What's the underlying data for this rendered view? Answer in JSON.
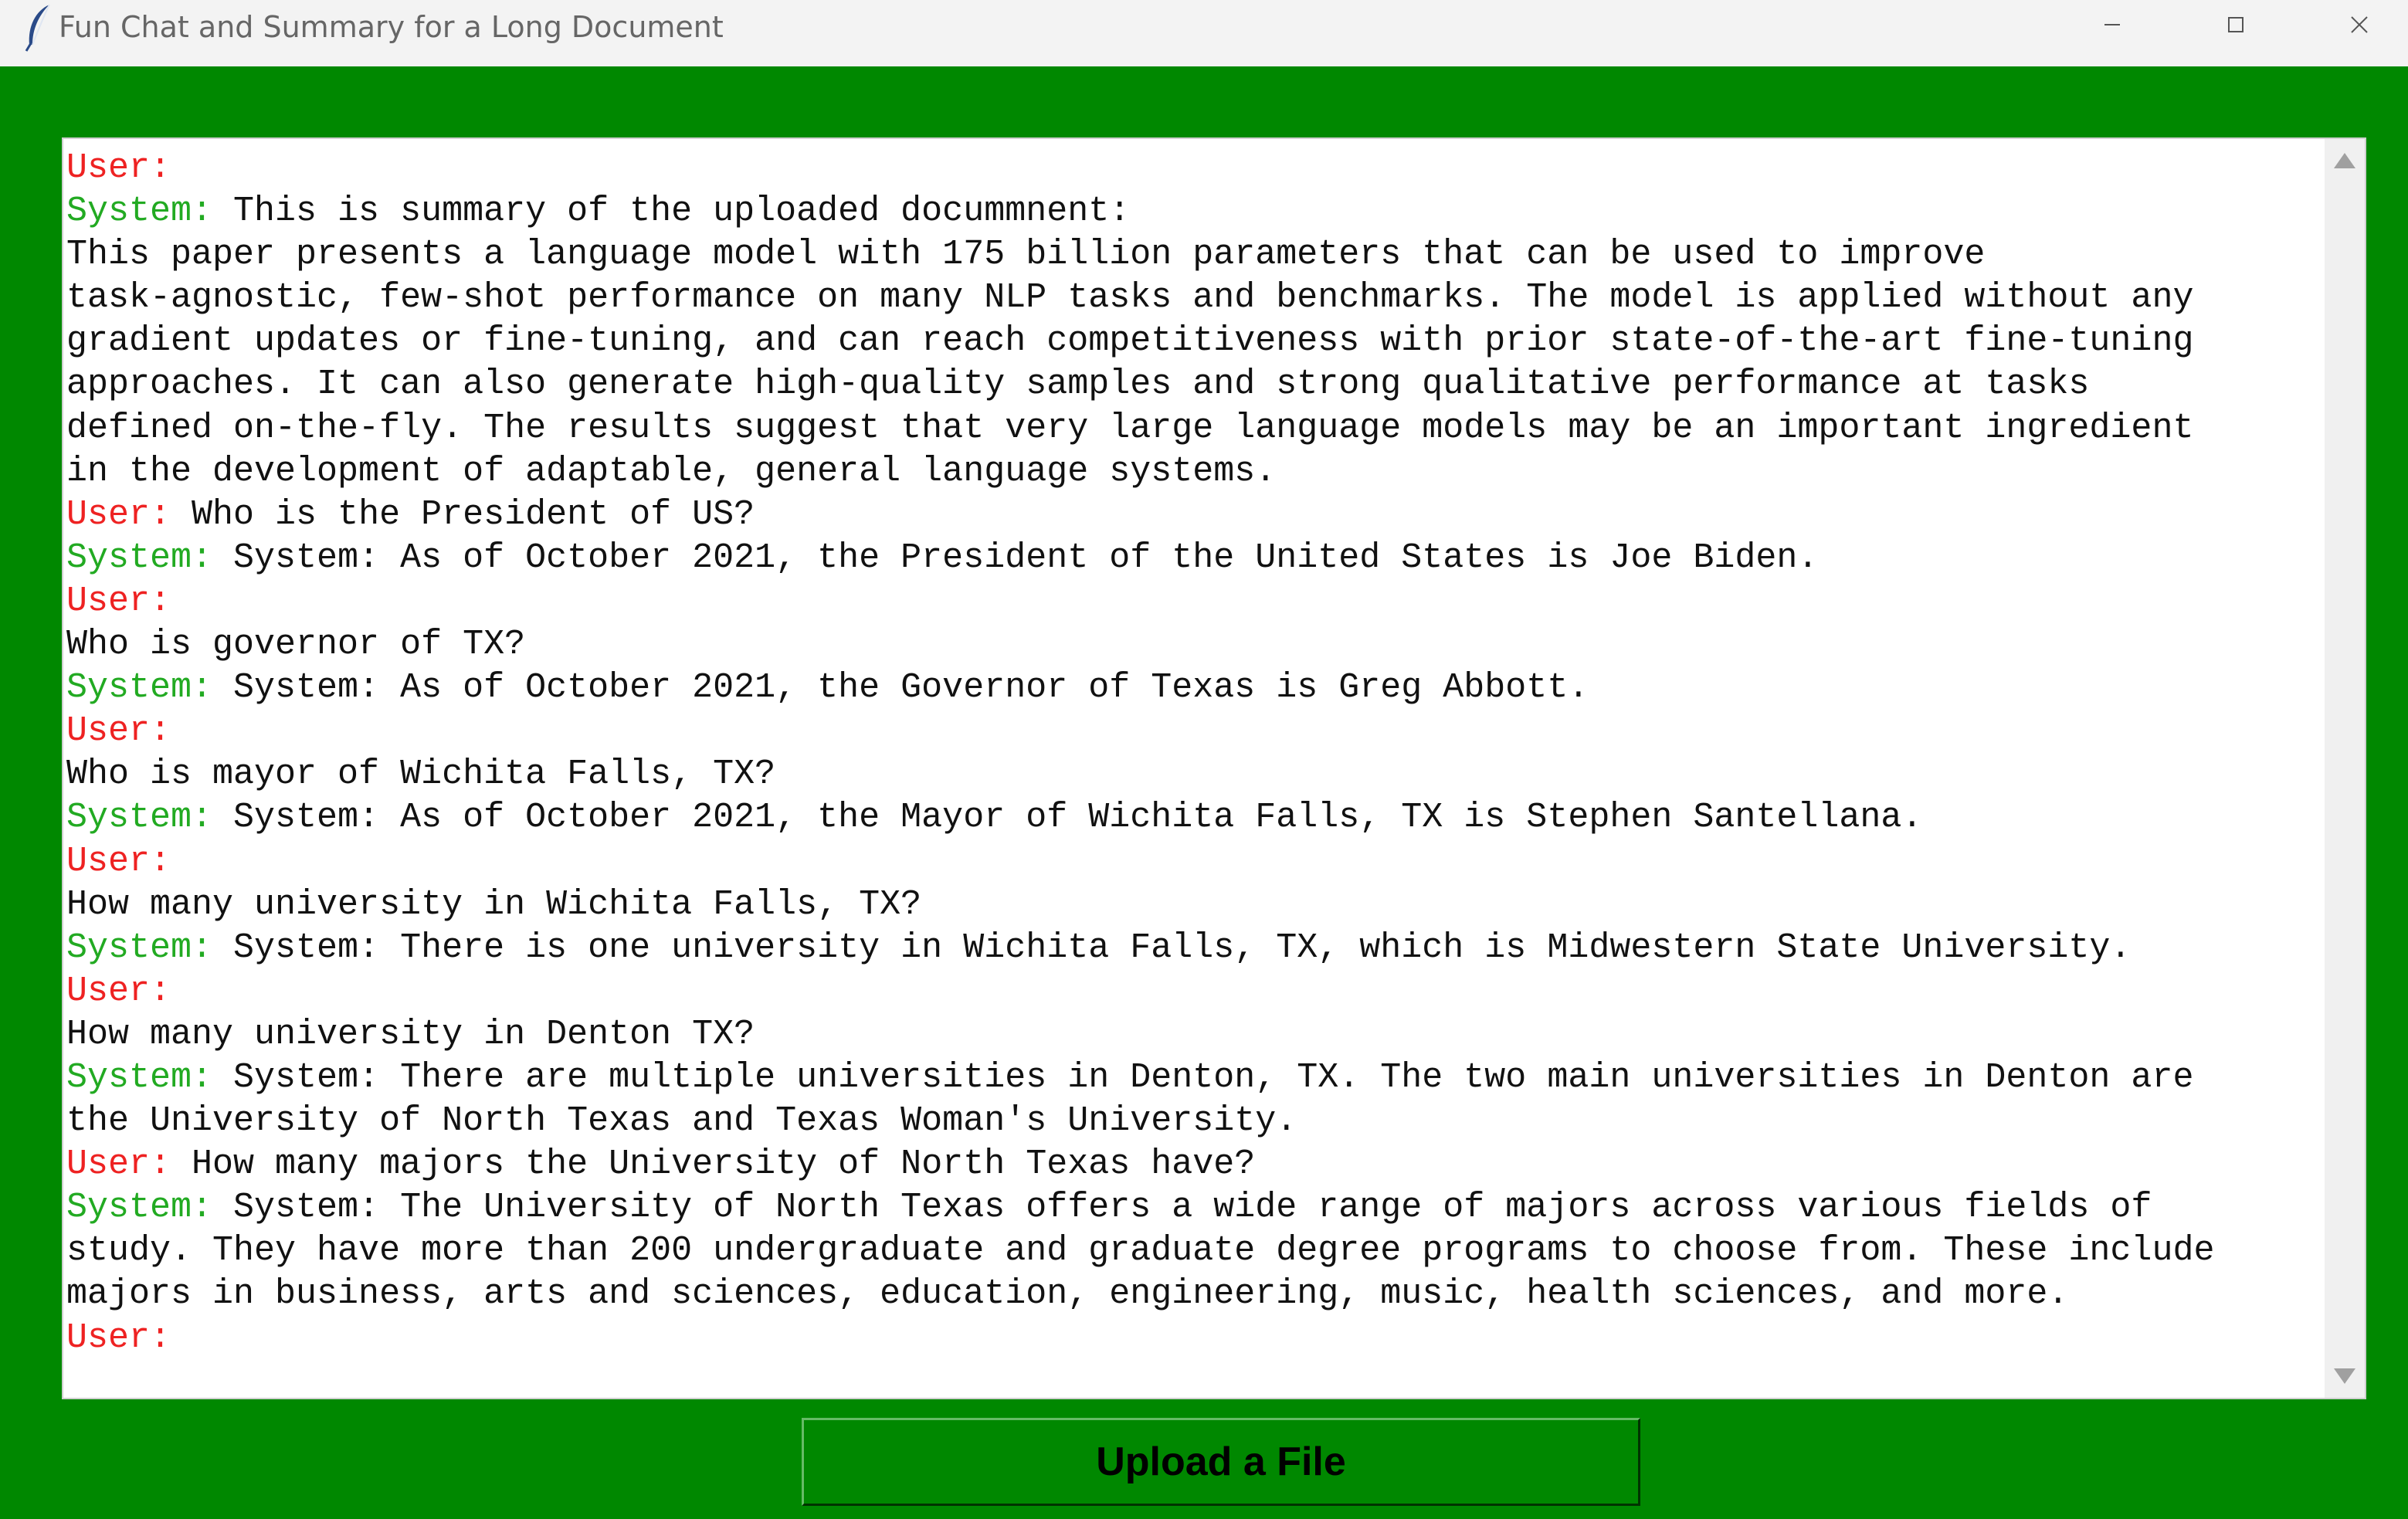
{
  "window": {
    "title": "Fun Chat and Summary for a Long Document",
    "min_glyph": "—",
    "max_glyph": "☐",
    "close_glyph": "✕"
  },
  "chat": {
    "lines": [
      {
        "speaker": "User:",
        "role": "user",
        "text": ""
      },
      {
        "speaker": "System:",
        "role": "system",
        "text": " This is summary of the uploaded docummnent:"
      },
      {
        "speaker": "",
        "role": "plain",
        "text": "This paper presents a language model with 175 billion parameters that can be used to improve"
      },
      {
        "speaker": "",
        "role": "plain",
        "text": "task-agnostic, few-shot performance on many NLP tasks and benchmarks. The model is applied without any"
      },
      {
        "speaker": "",
        "role": "plain",
        "text": "gradient updates or fine-tuning, and can reach competitiveness with prior state-of-the-art fine-tuning"
      },
      {
        "speaker": "",
        "role": "plain",
        "text": "approaches. It can also generate high-quality samples and strong qualitative performance at tasks"
      },
      {
        "speaker": "",
        "role": "plain",
        "text": "defined on-the-fly. The results suggest that very large language models may be an important ingredient"
      },
      {
        "speaker": "",
        "role": "plain",
        "text": "in the development of adaptable, general language systems."
      },
      {
        "speaker": "User:",
        "role": "user",
        "text": " Who is the President of US?"
      },
      {
        "speaker": "System:",
        "role": "system",
        "text": " System: As of October 2021, the President of the United States is Joe Biden."
      },
      {
        "speaker": "User:",
        "role": "user",
        "text": ""
      },
      {
        "speaker": "",
        "role": "plain",
        "text": "Who is governor of TX?"
      },
      {
        "speaker": "System:",
        "role": "system",
        "text": " System: As of October 2021, the Governor of Texas is Greg Abbott."
      },
      {
        "speaker": "User:",
        "role": "user",
        "text": ""
      },
      {
        "speaker": "",
        "role": "plain",
        "text": "Who is mayor of Wichita Falls, TX?"
      },
      {
        "speaker": "System:",
        "role": "system",
        "text": " System: As of October 2021, the Mayor of Wichita Falls, TX is Stephen Santellana."
      },
      {
        "speaker": "User:",
        "role": "user",
        "text": ""
      },
      {
        "speaker": "",
        "role": "plain",
        "text": "How many university in Wichita Falls, TX?"
      },
      {
        "speaker": "System:",
        "role": "system",
        "text": " System: There is one university in Wichita Falls, TX, which is Midwestern State University."
      },
      {
        "speaker": "User:",
        "role": "user",
        "text": ""
      },
      {
        "speaker": "",
        "role": "plain",
        "text": "How many university in Denton TX?"
      },
      {
        "speaker": "System:",
        "role": "system",
        "text": " System: There are multiple universities in Denton, TX. The two main universities in Denton are"
      },
      {
        "speaker": "",
        "role": "plain",
        "text": "the University of North Texas and Texas Woman's University."
      },
      {
        "speaker": "User:",
        "role": "user",
        "text": " How many majors the University of North Texas have?"
      },
      {
        "speaker": "System:",
        "role": "system",
        "text": " System: The University of North Texas offers a wide range of majors across various fields of"
      },
      {
        "speaker": "",
        "role": "plain",
        "text": "study. They have more than 200 undergraduate and graduate degree programs to choose from. These include"
      },
      {
        "speaker": "",
        "role": "plain",
        "text": "majors in business, arts and sciences, education, engineering, music, health sciences, and more."
      },
      {
        "speaker": "User:",
        "role": "user",
        "text": ""
      }
    ]
  },
  "upload_button": {
    "label": "Upload a File"
  },
  "colors": {
    "background": "#008800",
    "user_label": "#ee2222",
    "system_label": "#22aa22",
    "text_area": "#ffffff"
  },
  "icons": {
    "app": "feather-icon",
    "scroll_up": "triangle-up-icon",
    "scroll_down": "triangle-down-icon"
  }
}
